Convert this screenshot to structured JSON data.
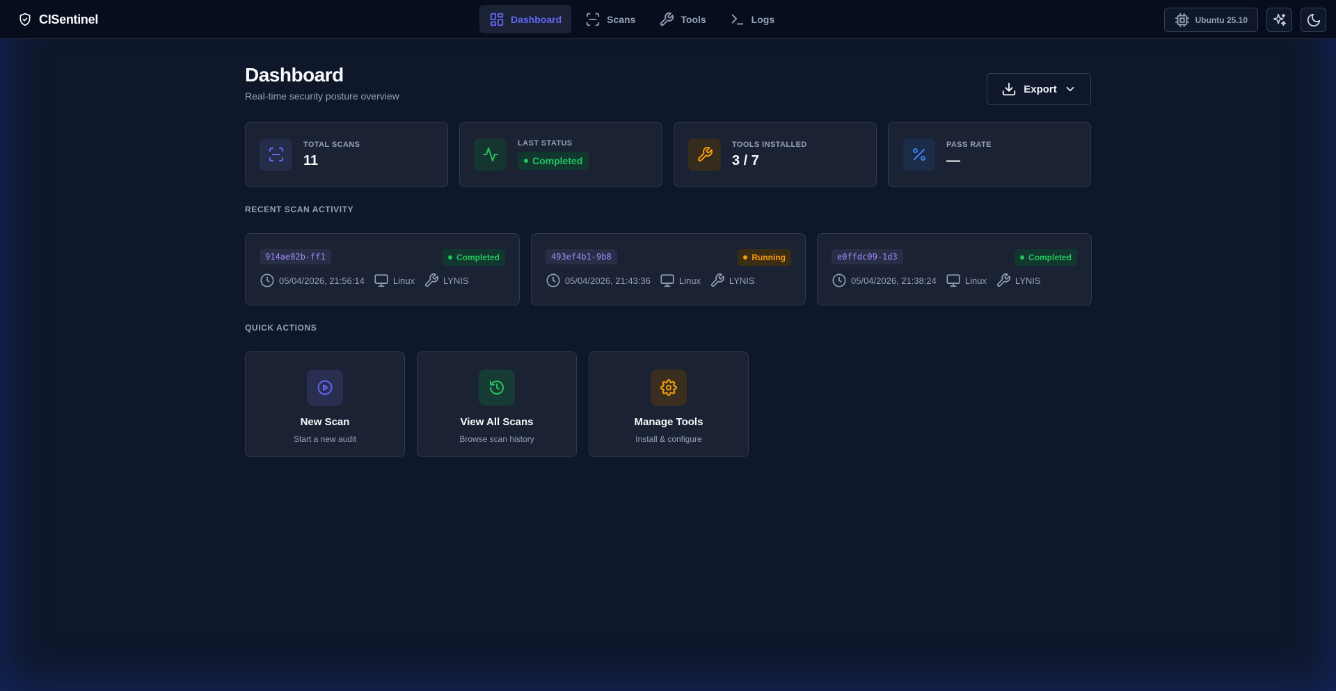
{
  "app": {
    "name": "CISentinel"
  },
  "nav": {
    "items": [
      {
        "label": "Dashboard",
        "icon": "dashboard-icon",
        "active": true
      },
      {
        "label": "Scans",
        "icon": "scan-icon"
      },
      {
        "label": "Tools",
        "icon": "wrench-icon"
      },
      {
        "label": "Logs",
        "icon": "terminal-icon"
      }
    ],
    "os_label": "Ubuntu 25.10"
  },
  "page": {
    "title": "Dashboard",
    "subtitle": "Real-time security posture overview",
    "export_label": "Export"
  },
  "stats": [
    {
      "label": "Total Scans",
      "value": "11",
      "icon": "scan-icon",
      "color": "#6366f1"
    },
    {
      "label": "Last Status",
      "value": "Completed",
      "icon": "activity-icon",
      "color": "#22c55e"
    },
    {
      "label": "Tools Installed",
      "value": "3 / 7",
      "icon": "wrench-icon",
      "color": "#f59e0b"
    },
    {
      "label": "Pass Rate",
      "value": "—",
      "icon": "percent-icon",
      "color": "#3b82f6"
    }
  ],
  "recent": {
    "title": "Recent Scan Activity",
    "items": [
      {
        "id": "914ae02b-ff1",
        "status": "Completed",
        "date": "05/04/2026, 21:56:14",
        "os": "Linux",
        "tool": "LYNIS"
      },
      {
        "id": "493ef4b1-9b8",
        "status": "Running",
        "date": "05/04/2026, 21:43:36",
        "os": "Linux",
        "tool": "LYNIS"
      },
      {
        "id": "e0ffdc09-1d3",
        "status": "Completed",
        "date": "05/04/2026, 21:38:24",
        "os": "Linux",
        "tool": "LYNIS"
      }
    ]
  },
  "quick_actions": {
    "title": "Quick Actions",
    "items": [
      {
        "title": "New Scan",
        "subtitle": "Start a new audit",
        "icon": "play-circle-icon",
        "color": "#6366f1"
      },
      {
        "title": "View All Scans",
        "subtitle": "Browse scan history",
        "icon": "history-icon",
        "color": "#22c55e"
      },
      {
        "title": "Manage Tools",
        "subtitle": "Install & configure",
        "icon": "gear-icon",
        "color": "#f59e0b"
      }
    ]
  },
  "colors": {
    "background": "#0f172a",
    "navbar": "#070d1d",
    "card": "#1a2233",
    "accent": "#6366f1",
    "success": "#22c55e",
    "warning": "#f59e0b",
    "info": "#3b82f6"
  }
}
